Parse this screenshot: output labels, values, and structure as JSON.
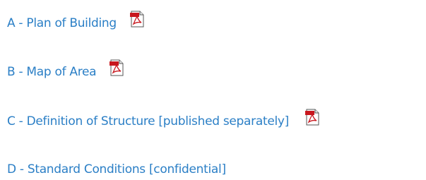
{
  "documents": [
    {
      "label": "A - Plan of Building",
      "has_pdf": true,
      "icon": "pdf-icon"
    },
    {
      "label": "B - Map of Area",
      "has_pdf": true,
      "icon": "pdf-icon"
    },
    {
      "label": "C - Definition of Structure [published separately]",
      "has_pdf": true,
      "icon": "pdf-icon"
    },
    {
      "label": "D - Standard Conditions [confidential]",
      "has_pdf": false
    }
  ],
  "colors": {
    "link": "#2b7fc6",
    "pdf_red": "#c8171e",
    "background": "#ffffff"
  }
}
